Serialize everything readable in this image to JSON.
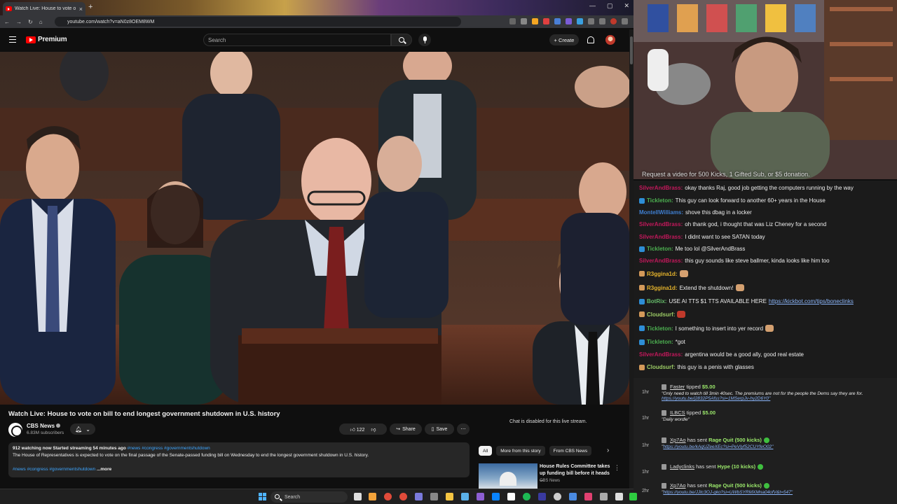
{
  "browser": {
    "tab_title": "Watch Live: House to vote o",
    "tab_close": "×",
    "new_tab": "+",
    "window_controls": [
      "—",
      "▢",
      "✕"
    ],
    "url": "youtube.com/watch?v=aN0z8OEM8WM"
  },
  "youtube": {
    "logo_text": "Premium",
    "search_placeholder": "Search",
    "create_label": "Create",
    "video_title": "Watch Live: House to vote on bill to end longest government shutdown in U.S. history",
    "channel_name": "CBS News",
    "subscribers": "6.83M subscribers",
    "likes": "122",
    "share_label": "Share",
    "save_label": "Save",
    "more_label": "⋯",
    "desc_stats": "912 watching now  Started streaming 54 minutes ago",
    "desc_tags_top": "#news #congress #governmentshutdown",
    "desc_text": "The House of Representatives is expected to vote on the final passage of the Senate-passed funding bill on Wednesday to end the longest government shutdown in U.S. history.",
    "desc_tags_bottom": "#news #congress #governmentshutdown",
    "desc_more": "...more",
    "chat_disabled": "Chat is disabled for this live stream.",
    "chips": [
      "All",
      "More from this story",
      "From CBS News"
    ],
    "chip_next": "›",
    "rec_title": "House Rules Committee takes up funding bill before it heads ...",
    "rec_channel": "CBS News",
    "rec_more": "⋮"
  },
  "stream": {
    "request_bar": "Request a video for 500 Kicks, 1 Gifted Sub, or $5 donation.",
    "chat": [
      {
        "user": "SilverAndBrass",
        "color": "silver",
        "text": "okay thanks Raj, good job getting the computers running by the way"
      },
      {
        "user": "Tickleton",
        "color": "tick",
        "text": "This guy can look forward to another 60+ years in the House"
      },
      {
        "user": "MontellWilliams",
        "color": "mont",
        "text": "shove this dbag in a locker"
      },
      {
        "user": "SilverAndBrass",
        "color": "silver",
        "text": "oh thank god, i thought that was Liz Cheney for a second"
      },
      {
        "user": "SilverAndBrass",
        "color": "silver",
        "text": "I didnt want to see SATAN today"
      },
      {
        "user": "Tickleton",
        "color": "tick",
        "text": "Me too lol @SilverAndBrass"
      },
      {
        "user": "SilverAndBrass",
        "color": "silver",
        "text": "this guy sounds like steve ballmer, kinda looks like him too"
      },
      {
        "user": "R3ggina1d",
        "color": "r3",
        "text": ""
      },
      {
        "user": "R3ggina1d",
        "color": "r3",
        "text": "Extend the shutdown!"
      },
      {
        "user": "BotRix",
        "color": "bot",
        "text": "USE AI TTS $1 TTS AVAILABLE HERE",
        "link": "https://kickbot.com/tips/boneclinks"
      },
      {
        "user": "Cloudsurf",
        "color": "cloud",
        "text": ""
      },
      {
        "user": "Tickleton",
        "color": "tick",
        "text": "I something to insert into yer record"
      },
      {
        "user": "Tickleton",
        "color": "tick",
        "text": "*got"
      },
      {
        "user": "SilverAndBrass",
        "color": "silver",
        "text": "argentina would be a good ally, good real estate"
      },
      {
        "user": "Cloudsurf",
        "color": "cloud",
        "text": "this guy is a penis with glasses"
      }
    ],
    "donations": [
      {
        "time": "1hr",
        "name": "Faster",
        "action": "tipped",
        "amount": "$5.00",
        "sub": "\"Only need to watch till 3min 40sec. The premiums are not for the people the Dems say they are for.",
        "link": "https://youtu.be/j2832P5Afss?si=1MSerpJv-hy2D6Y0\""
      },
      {
        "time": "1hr",
        "name": "ILBCS",
        "action": "tipped",
        "amount": "$5.00",
        "sub": "\"Daily wordle\"",
        "link": ""
      },
      {
        "time": "1hr",
        "name": "Xp7Ao",
        "action": "has sent",
        "amount": "Rage Quit (500 kicks)",
        "sub": "\"",
        "link": "https://youtu.be/kAqUZeeXEc?si=PeVlyf52CUYfeO02\""
      },
      {
        "time": "1hr",
        "name": "Ladyclinks",
        "action": "has sent",
        "amount": "Hype (10 kicks)",
        "sub": "",
        "link": ""
      },
      {
        "time": "2hr",
        "name": "Xp7Ao",
        "action": "has sent",
        "amount": "Rage Quit (500 kicks)",
        "sub": "\"",
        "link": "https://youtu.be/JJtc3OJ-gko?si=UWbSYRMXMna04ofV&t=547\""
      }
    ]
  },
  "taskbar": {
    "search_placeholder": "Search"
  },
  "colors": {
    "yt_red": "#ff0000",
    "tip_green": "#9be86b",
    "link_blue": "#8ab4f8"
  }
}
